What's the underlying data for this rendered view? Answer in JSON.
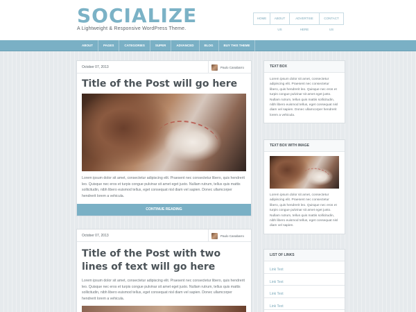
{
  "site": {
    "logo": "SOCIALIZE",
    "tagline": "A Lightweight & Responsive WordPress Theme."
  },
  "top_menu": [
    "HOME",
    "ABOUT US",
    "ADVERTISE HERE",
    "CONTACT US"
  ],
  "nav": [
    "ABOUT",
    "PAGES",
    "CATEGORIES",
    "SUPER",
    "ADVANCED",
    "BLOG",
    "BUY THIS THEME"
  ],
  "posts": [
    {
      "date": "October 07, 2013",
      "author": "Paulo Canabarro",
      "title": "Title of the Post will go here",
      "excerpt": "Lorem ipsum dolor sit amet, consectetur adipiscing elit. Praesent nec consectetur libero, quis hendrerit leo. Quisque nec eros et turpis congue pulvinar sit amet eget justo. Nullam rutrum, tellus quis mattis sollicitudin, nibh libero euismod tellus, eget consequat nisl diam vel sapien. Donec ullamcorper hendrerit lorem a vehicula.",
      "continue_label": "CONTINUE READING"
    },
    {
      "date": "October 07, 2013",
      "author": "Paulo Canabarro",
      "title": "Title of the Post with two lines of text will go here",
      "excerpt": "Lorem ipsum dolor sit amet, consectetur adipiscing elit. Praesent nec consectetur libero, quis hendrerit leo. Quisque nec eros et turpis congue pulvinar sit amet eget justo. Nullam rutrum, tellus quis mattis sollicitudin, nibh libero euismod tellus, eget consequat nisl diam vel sapien. Donec ullamcorper hendrerit lorem a vehicula."
    }
  ],
  "sidebar": {
    "text_box": {
      "title": "TEXT BOX",
      "text": "Lorem ipsum dolor sit amet, consectetur adipiscing elit. Praesent nec consectetur libero, quis hendrerit leo. Quisque nec eros et turpis congue pulvinar sit amet eget justo. Nullam rutrum, tellus quis mattis sollicitudin, nibh libero euismod tellus, eget consequat nisl diam vel sapien. Donec ullamcorper hendrerit lorem a vehicula."
    },
    "text_box_image": {
      "title": "TEXT BOX WITH IMAGE",
      "text": "Lorem ipsum dolor sit amet, consectetur adipiscing elit. Praesent nec consectetur libero, quis hendrerit leo. Quisque nec eros et turpis congue pulvinar sit amet eget justo. Nullam rutrum, tellus quis mattis sollicitudin, nibh libero euismod tellus, eget consequat nisl diam vel sapien."
    },
    "links": {
      "title": "LIST OF LINKS",
      "items": [
        "Link Text",
        "Link Text",
        "Link Text",
        "Link Text"
      ]
    }
  },
  "colors": {
    "accent": "#7ab0c5",
    "background": "#e6eaed",
    "text": "#4b5358"
  }
}
